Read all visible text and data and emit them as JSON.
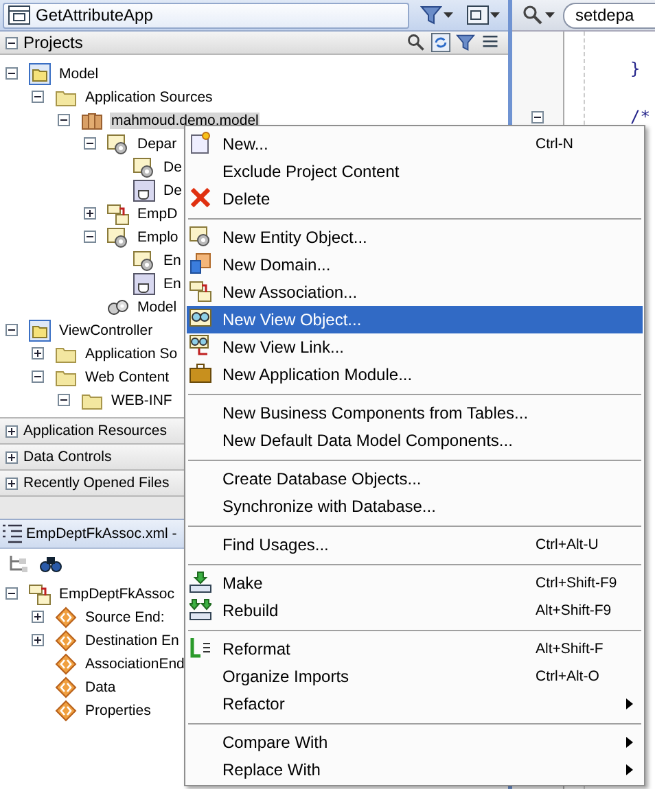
{
  "app_selector": {
    "title": "GetAttributeApp"
  },
  "projects_panel": {
    "title": "Projects",
    "expanded": true,
    "tree": [
      {
        "label": "Model",
        "expanded": true,
        "selected": false,
        "children": [
          {
            "label": "Application Sources",
            "expanded": true,
            "selected": false,
            "children": [
              {
                "label": "mahmoud.demo.model",
                "expanded": true,
                "selected": true,
                "children": [
                  {
                    "label": "Depar",
                    "expanded": true,
                    "selected": false,
                    "children": [
                      {
                        "label": "De",
                        "selected": false
                      },
                      {
                        "label": "De",
                        "selected": false
                      }
                    ]
                  },
                  {
                    "label": "EmpD",
                    "expanded": false,
                    "selected": false
                  },
                  {
                    "label": "Emplo",
                    "expanded": true,
                    "selected": false,
                    "children": [
                      {
                        "label": "En",
                        "selected": false
                      },
                      {
                        "label": "En",
                        "selected": false
                      }
                    ]
                  },
                  {
                    "label": "Model",
                    "selected": false
                  }
                ]
              }
            ]
          }
        ]
      },
      {
        "label": "ViewController",
        "expanded": true,
        "selected": false,
        "children": [
          {
            "label": "Application So",
            "expanded": false,
            "selected": false
          },
          {
            "label": "Web Content",
            "expanded": true,
            "selected": false,
            "children": [
              {
                "label": "WEB-INF",
                "expanded": true,
                "selected": false
              }
            ]
          }
        ]
      }
    ]
  },
  "accordions": [
    {
      "title": "Application Resources",
      "expanded": false
    },
    {
      "title": "Data Controls",
      "expanded": false
    },
    {
      "title": "Recently Opened Files",
      "expanded": false
    }
  ],
  "structure_panel": {
    "title": "EmpDeptFkAssoc.xml -",
    "tree": [
      {
        "label": "EmpDeptFkAssoc",
        "expanded": true,
        "children": [
          {
            "label": "Source End:",
            "expanded": false
          },
          {
            "label": "Destination En",
            "expanded": false
          },
          {
            "label": "AssociationEnd"
          },
          {
            "label": "Data"
          },
          {
            "label": "Properties"
          }
        ]
      }
    ]
  },
  "editor": {
    "search": {
      "value": "setdepa"
    },
    "lines": [
      {
        "text": "}"
      },
      {
        "text": "/*",
        "expanded": true
      }
    ]
  },
  "context_menu": {
    "items": [
      {
        "kind": "item",
        "label": "New...",
        "shortcut": "Ctrl-N",
        "selected": false
      },
      {
        "kind": "item",
        "label": "Exclude Project Content",
        "selected": false
      },
      {
        "kind": "item",
        "label": "Delete",
        "selected": false
      },
      {
        "kind": "separator"
      },
      {
        "kind": "item",
        "label": "New Entity Object...",
        "selected": false
      },
      {
        "kind": "item",
        "label": "New Domain...",
        "selected": false
      },
      {
        "kind": "item",
        "label": "New Association...",
        "selected": false
      },
      {
        "kind": "item",
        "label": "New View Object...",
        "selected": true
      },
      {
        "kind": "item",
        "label": "New View Link...",
        "selected": false
      },
      {
        "kind": "item",
        "label": "New Application Module...",
        "selected": false
      },
      {
        "kind": "separator"
      },
      {
        "kind": "item",
        "label": "New Business Components from Tables...",
        "selected": false
      },
      {
        "kind": "item",
        "label": "New Default Data Model Components...",
        "selected": false
      },
      {
        "kind": "separator"
      },
      {
        "kind": "item",
        "label": "Create Database Objects...",
        "selected": false
      },
      {
        "kind": "item",
        "label": "Synchronize with Database...",
        "selected": false
      },
      {
        "kind": "separator"
      },
      {
        "kind": "item",
        "label": "Find Usages...",
        "shortcut": "Ctrl+Alt-U",
        "selected": false
      },
      {
        "kind": "separator"
      },
      {
        "kind": "item",
        "label": "Make",
        "shortcut": "Ctrl+Shift-F9",
        "selected": false
      },
      {
        "kind": "item",
        "label": "Rebuild",
        "shortcut": "Alt+Shift-F9",
        "selected": false
      },
      {
        "kind": "separator"
      },
      {
        "kind": "item",
        "label": "Reformat",
        "shortcut": "Alt+Shift-F",
        "selected": false
      },
      {
        "kind": "item",
        "label": "Organize Imports",
        "shortcut": "Ctrl+Alt-O",
        "selected": false
      },
      {
        "kind": "item",
        "label": "Refactor",
        "submenu": true,
        "selected": false
      },
      {
        "kind": "separator"
      },
      {
        "kind": "item",
        "label": "Compare With",
        "submenu": true,
        "selected": false
      },
      {
        "kind": "item",
        "label": "Replace With",
        "submenu": true,
        "selected": false
      }
    ]
  }
}
